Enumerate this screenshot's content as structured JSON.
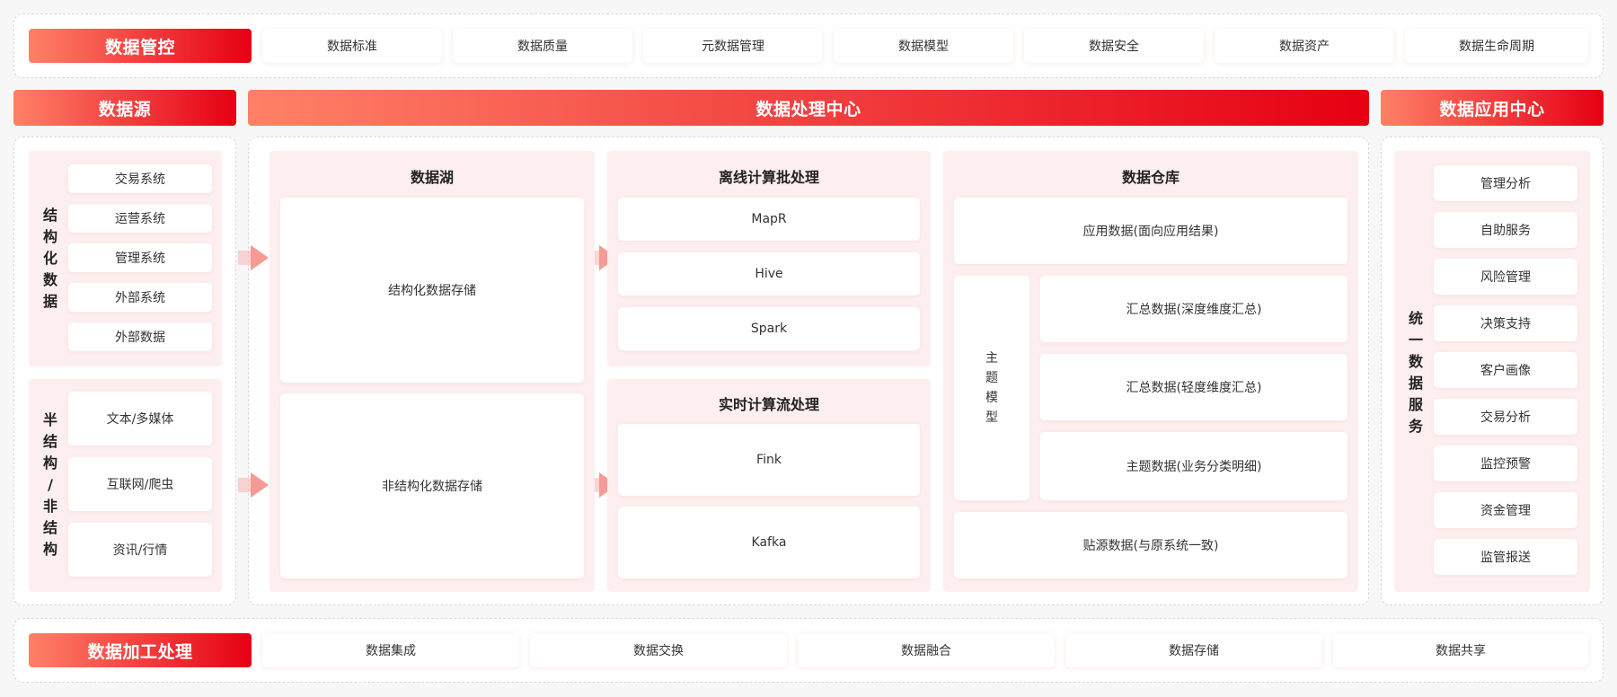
{
  "governance": {
    "title": "数据管控",
    "items": [
      "数据标准",
      "数据质量",
      "元数据管理",
      "数据模型",
      "数据安全",
      "数据资产",
      "数据生命周期"
    ]
  },
  "headers": {
    "source": "数据源",
    "processing": "数据处理中心",
    "application": "数据应用中心"
  },
  "sources": {
    "structured_label": [
      "结",
      "构",
      "化",
      "数",
      "据"
    ],
    "structured_items": [
      "交易系统",
      "运营系统",
      "管理系统",
      "外部系统",
      "外部数据"
    ],
    "semi_label": [
      "半",
      "结",
      "构",
      "/",
      "非",
      "结",
      "构"
    ],
    "semi_items": [
      "文本/多媒体",
      "互联网/爬虫",
      "资讯/行情"
    ]
  },
  "lake": {
    "title": "数据湖",
    "structured": "结构化数据存储",
    "unstructured": "非结构化数据存储"
  },
  "offline": {
    "title": "离线计算批处理",
    "items": [
      "MapR",
      "Hive",
      "Spark"
    ]
  },
  "realtime": {
    "title": "实时计算流处理",
    "items": [
      "Fink",
      "Kafka"
    ]
  },
  "warehouse": {
    "title": "数据仓库",
    "app_data": "应用数据(面向应用结果)",
    "subject_label": [
      "主",
      "题",
      "模",
      "型"
    ],
    "summary_deep": "汇总数据(深度维度汇总)",
    "summary_light": "汇总数据(轻度维度汇总)",
    "subject_data": "主题数据(业务分类明细)",
    "source_data": "贴源数据(与原系统一致)"
  },
  "application": {
    "label": [
      "统",
      "一",
      "数",
      "据",
      "服",
      "务"
    ],
    "items": [
      "管理分析",
      "自助服务",
      "风险管理",
      "决策支持",
      "客户画像",
      "交易分析",
      "监控预警",
      "资金管理",
      "监管报送"
    ]
  },
  "processing_row": {
    "title": "数据加工处理",
    "items": [
      "数据集成",
      "数据交换",
      "数据融合",
      "数据存储",
      "数据共享"
    ]
  }
}
